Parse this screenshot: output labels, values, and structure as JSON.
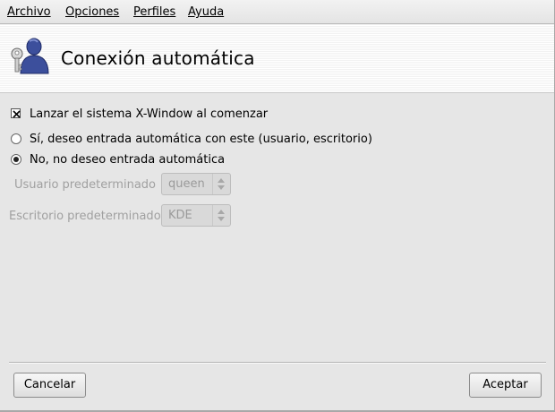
{
  "menu": [
    {
      "label": "Archivo"
    },
    {
      "label": "Opciones"
    },
    {
      "label": "Perfiles"
    },
    {
      "label": "Ayuda"
    }
  ],
  "header": {
    "title": "Conexión automática",
    "icon": "user-key-icon"
  },
  "options": {
    "launch_x": {
      "label": "Lanzar el sistema X-Window al comenzar",
      "checked": true
    },
    "autologin_yes": {
      "label": "Sí, deseo entrada automática con este (usuario, escritorio)",
      "selected": false
    },
    "autologin_no": {
      "label": "No, no deseo entrada automática",
      "selected": true
    }
  },
  "fields": {
    "user": {
      "label": "Usuario predeterminado",
      "value": "queen",
      "enabled": false
    },
    "desktop": {
      "label": "Escritorio predeterminado",
      "value": "KDE",
      "enabled": false
    }
  },
  "buttons": {
    "cancel": "Cancelar",
    "accept": "Aceptar"
  },
  "colors": {
    "background": "#e6e6e6",
    "icon_blue": "#3c4f9c",
    "disabled_text": "#a0a0a0"
  }
}
